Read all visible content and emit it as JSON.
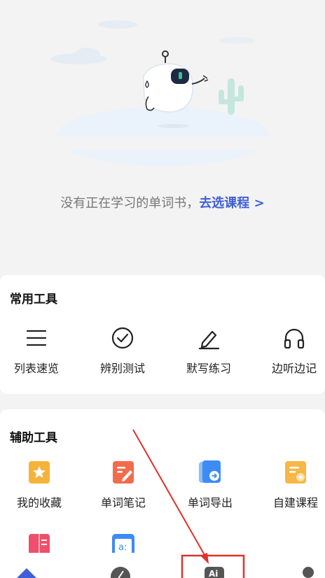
{
  "empty_state": {
    "message": "没有正在学习的单词书，",
    "link": "去选课程 >"
  },
  "common_tools": {
    "title": "常用工具",
    "items": [
      {
        "label": "列表速览",
        "icon": "list-icon"
      },
      {
        "label": "辨别测试",
        "icon": "check-circle-icon"
      },
      {
        "label": "默写练习",
        "icon": "pencil-icon"
      },
      {
        "label": "边听边记",
        "icon": "headphones-icon"
      }
    ]
  },
  "assist_tools": {
    "title": "辅助工具",
    "items": [
      {
        "label": "我的收藏",
        "icon": "star-bookmark-icon",
        "color": "#f6b33a"
      },
      {
        "label": "单词笔记",
        "icon": "note-pen-icon",
        "color": "#f26b4b"
      },
      {
        "label": "单词导出",
        "icon": "export-icon",
        "color": "#3d8bf5"
      },
      {
        "label": "自建课程",
        "icon": "add-course-icon",
        "color": "#f8b646"
      }
    ]
  },
  "tabbar": {
    "tabs": [
      "home-icon",
      "discover-icon",
      "ai-icon",
      "profile-icon"
    ]
  },
  "colors": {
    "accent": "#3f5fd6",
    "annotation": "#e0312a"
  }
}
